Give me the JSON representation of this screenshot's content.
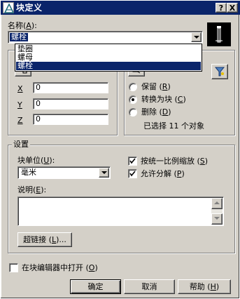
{
  "window": {
    "title": "块定义",
    "help_glyph": "?",
    "close_glyph": "X"
  },
  "name": {
    "label_main": "名称",
    "label_open": "(",
    "label_key": "A",
    "label_close": "):",
    "value": "螺栓",
    "options": [
      "垫圈",
      "螺母",
      "螺栓"
    ],
    "selected_index": 2
  },
  "base_point": {
    "x_label": "X",
    "y_label": "Y",
    "z_label": "Z",
    "x_value": "0",
    "y_value": "0",
    "z_value": "0"
  },
  "objects": {
    "radios": [
      {
        "label": "保留",
        "key": "R",
        "checked": false
      },
      {
        "label": "转换为块",
        "key": "C",
        "checked": true
      },
      {
        "label": "删除",
        "key": "D",
        "checked": false
      }
    ],
    "status": "已选择 11 个对象"
  },
  "settings": {
    "group_label": "设置",
    "unit_label_main": "块单位",
    "unit_label_key": "U",
    "unit_value": "毫米",
    "scale_uniform": {
      "label": "按统一比例缩放",
      "key": "S",
      "checked": true
    },
    "allow_explode": {
      "label": "允许分解",
      "key": "P",
      "checked": true
    },
    "desc_label_main": "说明",
    "desc_label_key": "E",
    "description": "",
    "hyperlink_main": "超链接",
    "hyperlink_key": "L",
    "hyperlink_tail": ")..."
  },
  "open_in_editor": {
    "label": "在块编辑器中打开",
    "key": "O",
    "checked": false
  },
  "buttons": {
    "ok": "确定",
    "cancel": "取消",
    "help_main": "帮助",
    "help_key": "H"
  },
  "colors": {
    "titlebar": "#0a246a",
    "face": "#d4d0c8",
    "selection": "#0a246a"
  }
}
